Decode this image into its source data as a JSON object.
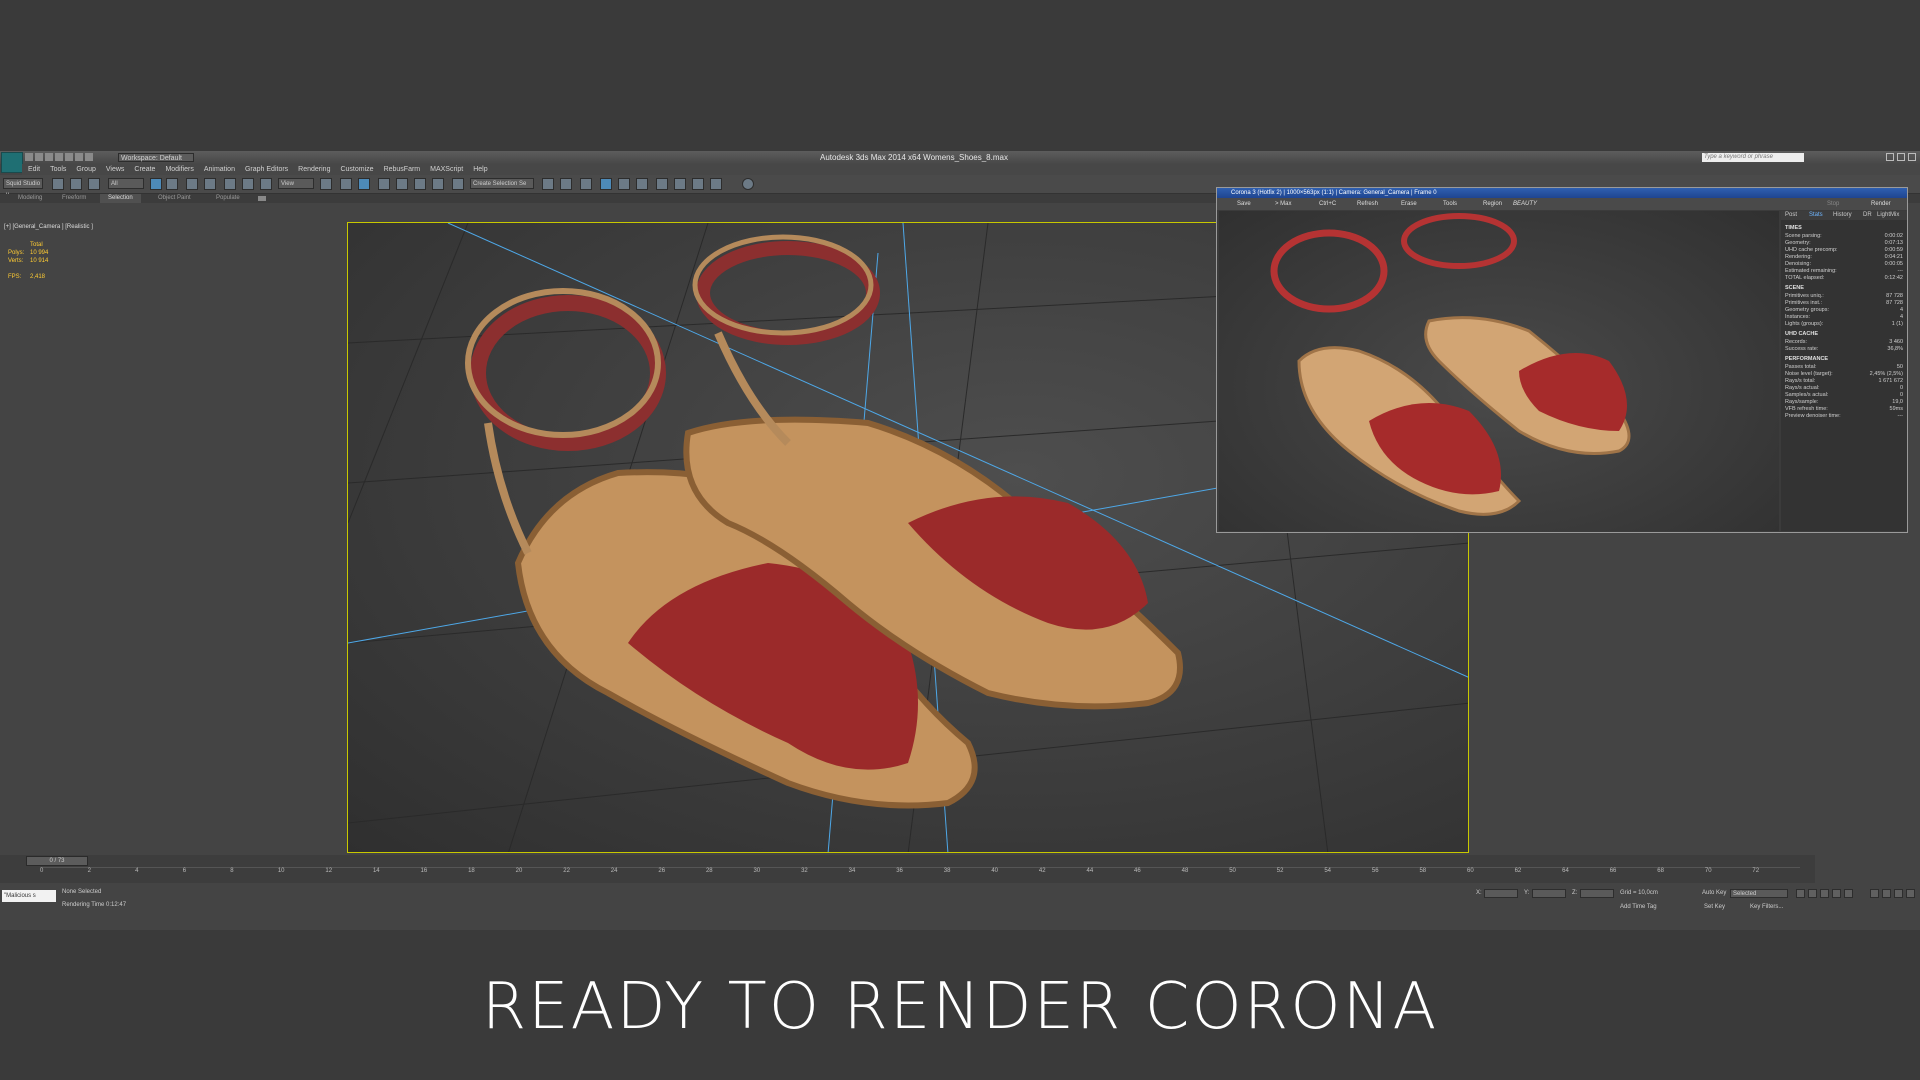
{
  "app": {
    "title": "Autodesk 3ds Max 2014 x64    Womens_Shoes_8.max",
    "workspace": "Workspace: Default",
    "search_placeholder": "Type a keyword or phrase",
    "menu": [
      "Edit",
      "Tools",
      "Group",
      "Views",
      "Create",
      "Modifiers",
      "Animation",
      "Graph Editors",
      "Rendering",
      "Customize",
      "RebusFarm",
      "MAXScript",
      "Help"
    ],
    "toolbar": {
      "squid": "Squid Studio v",
      "filter": "All",
      "view": "View",
      "selection_set": "Create Selection Se"
    },
    "ribbon_tabs": [
      "Modeling",
      "Freeform",
      "Selection",
      "Object Paint",
      "Populate"
    ],
    "active_ribbon": "Selection"
  },
  "viewport": {
    "label": "[+] [General_Camera ] [Realistic ]",
    "stats": {
      "total": "Total",
      "polys_label": "Polys:",
      "polys": "10 994",
      "verts_label": "Verts:",
      "verts": "10 914",
      "fps_label": "FPS:",
      "fps": "2,418"
    }
  },
  "timeline": {
    "frame": "0 / 73",
    "ticks": [
      "0",
      "2",
      "4",
      "6",
      "8",
      "10",
      "12",
      "14",
      "16",
      "18",
      "20",
      "22",
      "24",
      "26",
      "28",
      "30",
      "32",
      "34",
      "36",
      "38",
      "40",
      "42",
      "44",
      "46",
      "48",
      "50",
      "52",
      "54",
      "56",
      "58",
      "60",
      "62",
      "64",
      "66",
      "68",
      "70",
      "72"
    ]
  },
  "status": {
    "script": "\"Malicious s",
    "line1": "None Selected",
    "line2": "Rendering Time  0:12:47",
    "grid": "Grid = 10,0cm",
    "auto_key": "Auto Key",
    "set_key": "Set Key",
    "key_mode": "Selected",
    "key_filters": "Key Filters...",
    "add_time_tag": "Add Time Tag",
    "x": "X:",
    "y": "Y:",
    "z": "Z:"
  },
  "vfb": {
    "title": "Corona 3 (Hotfix 2) | 1000×563px (1:1) | Camera: General_Camera | Frame 0",
    "tools": [
      "Save",
      "> Max",
      "Ctrl+C",
      "Refresh",
      "Erase",
      "Tools",
      "Region"
    ],
    "pass": "BEAUTY",
    "stop": "Stop",
    "render": "Render",
    "tabs": [
      "Post",
      "Stats",
      "History",
      "DR",
      "LightMix"
    ],
    "active_tab": "Stats",
    "sections": [
      {
        "name": "TIMES",
        "rows": [
          [
            "Scene parsing:",
            "0:00:02"
          ],
          [
            "Geometry:",
            "0:07:13"
          ],
          [
            "UHD cache precomp:",
            "0:00:59"
          ],
          [
            "Rendering:",
            "0:04:21"
          ],
          [
            "Denoising:",
            "0:00:05"
          ],
          [
            "Estimated remaining:",
            "---"
          ],
          [
            "TOTAL elapsed:",
            "0:12:42"
          ]
        ]
      },
      {
        "name": "SCENE",
        "rows": [
          [
            "Primitives uniq.:",
            "87 728"
          ],
          [
            "Primitives inst.:",
            "87 728"
          ],
          [
            "Geometry groups:",
            "4"
          ],
          [
            "Instances:",
            "4"
          ],
          [
            "Lights (groups):",
            "1 (1)"
          ]
        ]
      },
      {
        "name": "UHD CACHE",
        "rows": [
          [
            "Records:",
            "3 460"
          ],
          [
            "Success rate:",
            "36,8%"
          ]
        ]
      },
      {
        "name": "PERFORMANCE",
        "rows": [
          [
            "Passes total:",
            "50"
          ],
          [
            "Noise level (target):",
            "2,45% (2,5%)"
          ],
          [
            "Rays/s total:",
            "1 671 672"
          ],
          [
            "Rays/s actual:",
            "0"
          ],
          [
            "Samples/s actual:",
            "0"
          ],
          [
            "Rays/sample:",
            "19,0"
          ],
          [
            "VFB refresh time:",
            "59ms"
          ],
          [
            "Preview denoiser time:",
            "---"
          ]
        ]
      }
    ]
  },
  "caption": "READY TO RENDER  CORONA",
  "colors": {
    "selection_border": "#c8c800",
    "title_blue": "#2f5fb0",
    "shoe_red": "#9b2a2a",
    "sole_tan": "#c4935e"
  }
}
